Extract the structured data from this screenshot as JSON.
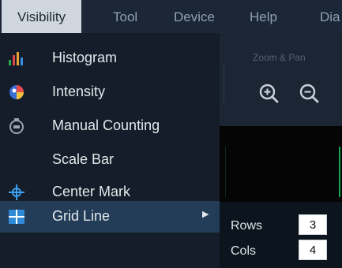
{
  "menubar": {
    "items": [
      "Visibility",
      "Tool",
      "Device",
      "Help",
      "Dia"
    ],
    "active_index": 0
  },
  "toolbar": {
    "group_label": "Zoom & Pan",
    "zoom_in_icon": "zoom-in-icon",
    "zoom_out_icon": "zoom-out-icon"
  },
  "visibility_menu": {
    "items": [
      {
        "label": "Histogram",
        "icon": "histogram-icon"
      },
      {
        "label": "Intensity",
        "icon": "intensity-icon"
      },
      {
        "label": "Manual Counting",
        "icon": "counter-icon"
      },
      {
        "label": "Scale Bar",
        "icon": "scale-bar-icon"
      },
      {
        "label": "Center Mark",
        "icon": "center-mark-icon"
      },
      {
        "label": "Grid Line",
        "icon": "grid-icon",
        "has_submenu": true,
        "selected": true
      }
    ]
  },
  "grid_submenu": {
    "rows_label": "Rows",
    "rows_value": "3",
    "cols_label": "Cols",
    "cols_value": "4"
  },
  "colors": {
    "menubar_bg": "#1b2736",
    "dropdown_bg": "#141d29",
    "selected_bg": "#233c57",
    "accent_blue": "#2f8ad8",
    "graph_green": "#13a94a"
  }
}
